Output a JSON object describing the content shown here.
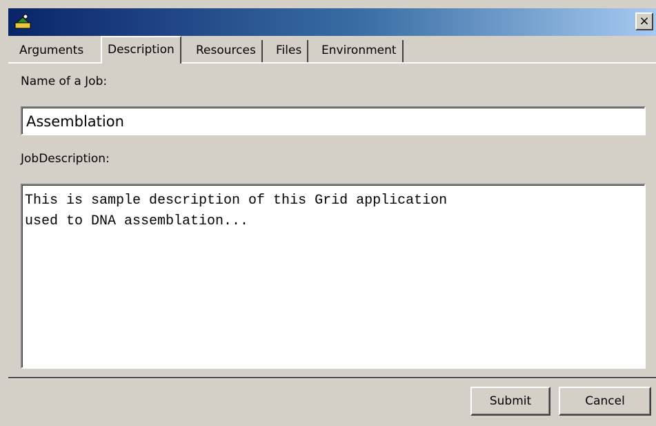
{
  "window": {
    "close_symbol": "×",
    "app_icon": "grid-app-icon"
  },
  "tabs": [
    {
      "label": "Arguments",
      "active": false
    },
    {
      "label": "Description",
      "active": true
    },
    {
      "label": "Resources",
      "active": false
    },
    {
      "label": "Files",
      "active": false
    },
    {
      "label": "Environment",
      "active": false
    }
  ],
  "form": {
    "job_name_label": "Name of a Job:",
    "job_name_value": "Assemblation",
    "description_label": "JobDescription:",
    "description_value": "This is sample description of this Grid application\nused to DNA assemblation..."
  },
  "buttons": {
    "submit_label": "Submit",
    "cancel_label": "Cancel"
  }
}
